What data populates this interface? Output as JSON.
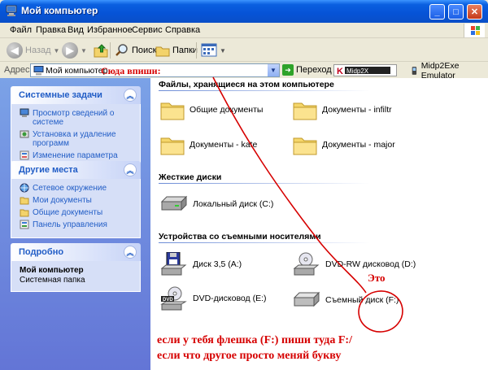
{
  "window": {
    "title": "Мой компьютер",
    "controls": {
      "minimize": "_",
      "maximize": "□",
      "close": "✕"
    }
  },
  "menu": [
    "Файл",
    "Правка",
    "Вид",
    "Избранное",
    "Сервис",
    "Справка"
  ],
  "toolbar": {
    "back_label": "Назад",
    "search_label": "Поиск",
    "folders_label": "Папки"
  },
  "address": {
    "label": "Адрес:",
    "value": "Мой компьютер",
    "go_label": "Переход",
    "midp_label": "Midp2Exe Emulator"
  },
  "left": {
    "system_tasks": {
      "title": "Системные задачи",
      "items": [
        "Просмотр сведений о системе",
        "Установка и удаление программ",
        "Изменение параметра"
      ]
    },
    "other_places": {
      "title": "Другие места",
      "items": [
        "Сетевое окружение",
        "Мои документы",
        "Общие документы",
        "Панель управления"
      ]
    },
    "details": {
      "title": "Подробно",
      "name": "Мой компьютер",
      "type": "Системная папка"
    }
  },
  "main": {
    "groups": {
      "files": "Файлы, хранящиеся на этом компьютере",
      "hard_drives": "Жесткие диски",
      "removable": "Устройства со съемными носителями"
    },
    "files": [
      "Общие документы",
      "Документы - infiltr",
      "Документы - kate",
      "Документы - major"
    ],
    "hard_drives": [
      "Локальный диск (C:)"
    ],
    "removable": [
      "Диск 3,5 (A:)",
      "DVD-RW дисковод (D:)",
      "DVD-дисковод (E:)",
      "Съемный диск (F:)"
    ]
  },
  "annotations": {
    "write_here": "Сюда впиши:",
    "this": "Это",
    "line1": "если у тебя флешка (F:) пиши туда F:/",
    "line2": "если что другое просто меняй букву",
    "color": "#d60000"
  },
  "colors": {
    "titlebar": "#0653d6",
    "taskpane": "#6375d6",
    "link": "#215dc6"
  }
}
